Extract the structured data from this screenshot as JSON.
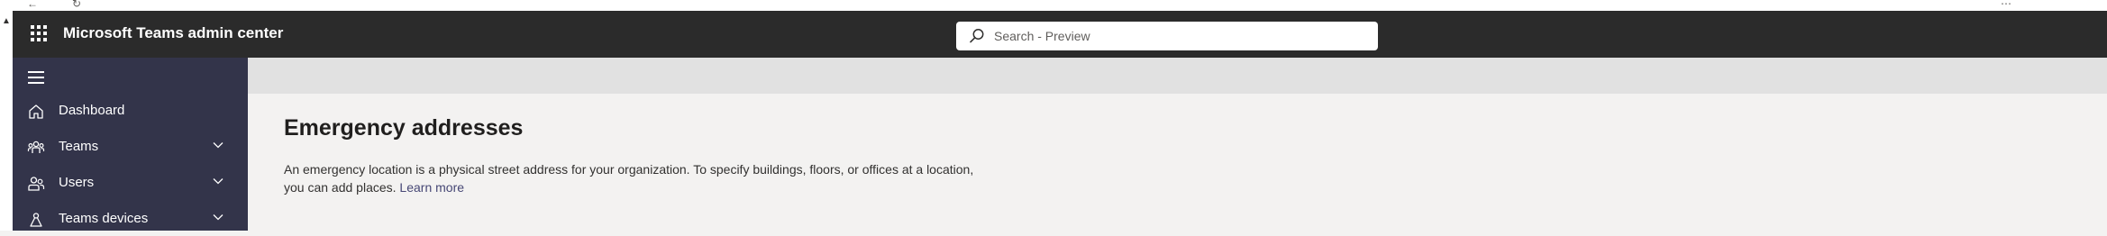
{
  "header": {
    "app_title": "Microsoft Teams admin center",
    "search_placeholder": "Search - Preview"
  },
  "sidebar": {
    "items": [
      {
        "label": "Dashboard",
        "icon": "home-icon",
        "expandable": false
      },
      {
        "label": "Teams",
        "icon": "teams-icon",
        "expandable": true
      },
      {
        "label": "Users",
        "icon": "users-icon",
        "expandable": true
      },
      {
        "label": "Teams devices",
        "icon": "devices-icon",
        "expandable": true
      }
    ]
  },
  "main": {
    "title": "Emergency addresses",
    "description_line1": "An emergency location is a physical street address for your organization. To specify buildings, floors, or offices at a location,",
    "description_line2": "you can add places.",
    "learn_more": "Learn more"
  },
  "colors": {
    "header_bg": "#2b2b2b",
    "sidebar_bg": "#33344a",
    "page_bg": "#f3f2f1",
    "link": "#464775"
  }
}
